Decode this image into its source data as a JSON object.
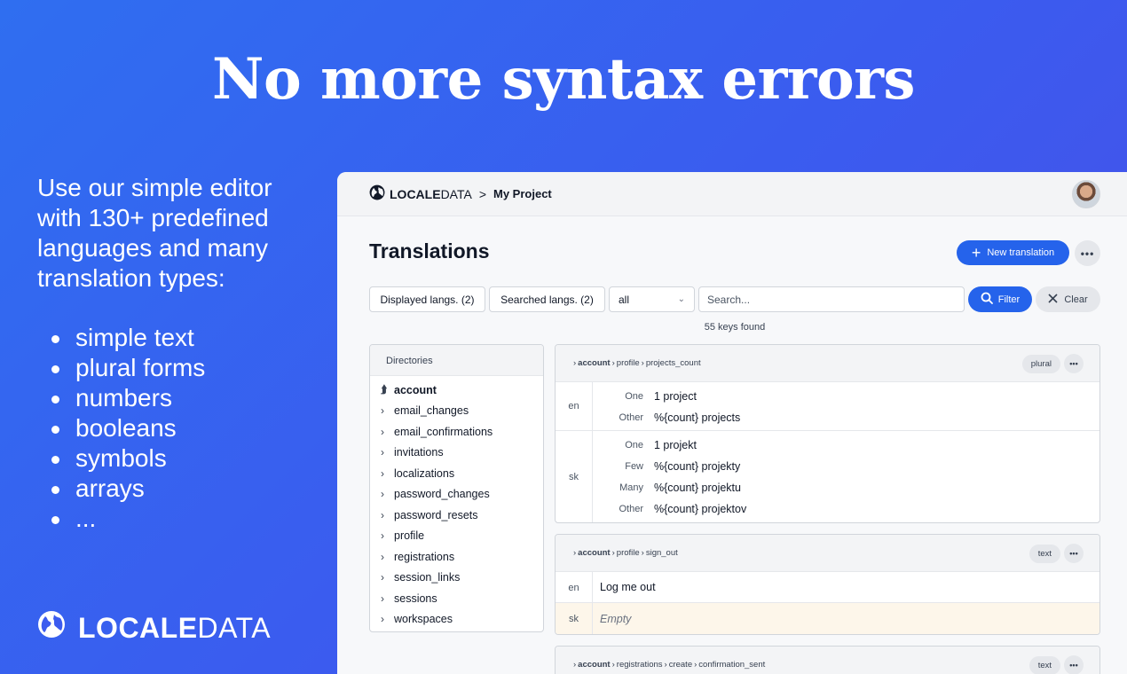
{
  "headline": "No more syntax errors",
  "intro": "Use our simple editor with 130+ predefined languages and many translation types:",
  "types": [
    "simple text",
    "plural forms",
    "numbers",
    "booleans",
    "symbols",
    "arrays",
    "..."
  ],
  "brand": {
    "strong": "LOCALE",
    "light": "DATA"
  },
  "app": {
    "logo": {
      "strong": "LOCALE",
      "light": "DATA"
    },
    "breadcrumb_sep": ">",
    "project": "My Project",
    "title": "Translations",
    "new_translation": "New translation",
    "more": "•••",
    "filters": {
      "displayed": "Displayed langs. (2)",
      "searched": "Searched langs. (2)",
      "scope": "all",
      "search_placeholder": "Search...",
      "filter": "Filter",
      "clear": "Clear"
    },
    "keys_found": "55 keys found",
    "directories": {
      "title": "Directories",
      "current": "account",
      "items": [
        "email_changes",
        "email_confirmations",
        "invitations",
        "localizations",
        "password_changes",
        "password_resets",
        "profile",
        "registrations",
        "session_links",
        "sessions",
        "workspaces"
      ]
    },
    "cards": [
      {
        "path": [
          "account",
          "profile",
          "projects_count"
        ],
        "type": "plural",
        "langs": [
          {
            "code": "en",
            "forms": [
              {
                "label": "One",
                "value": "1 project"
              },
              {
                "label": "Other",
                "value": "%{count} projects"
              }
            ]
          },
          {
            "code": "sk",
            "forms": [
              {
                "label": "One",
                "value": "1 projekt"
              },
              {
                "label": "Few",
                "value": "%{count} projekty"
              },
              {
                "label": "Many",
                "value": "%{count} projektu"
              },
              {
                "label": "Other",
                "value": "%{count} projektov"
              }
            ]
          }
        ]
      },
      {
        "path": [
          "account",
          "profile",
          "sign_out"
        ],
        "type": "text",
        "rows": [
          {
            "code": "en",
            "value": "Log me out"
          },
          {
            "code": "sk",
            "value": "Empty"
          }
        ]
      },
      {
        "path": [
          "account",
          "registrations",
          "create",
          "confirmation_sent"
        ],
        "type": "text"
      }
    ]
  }
}
